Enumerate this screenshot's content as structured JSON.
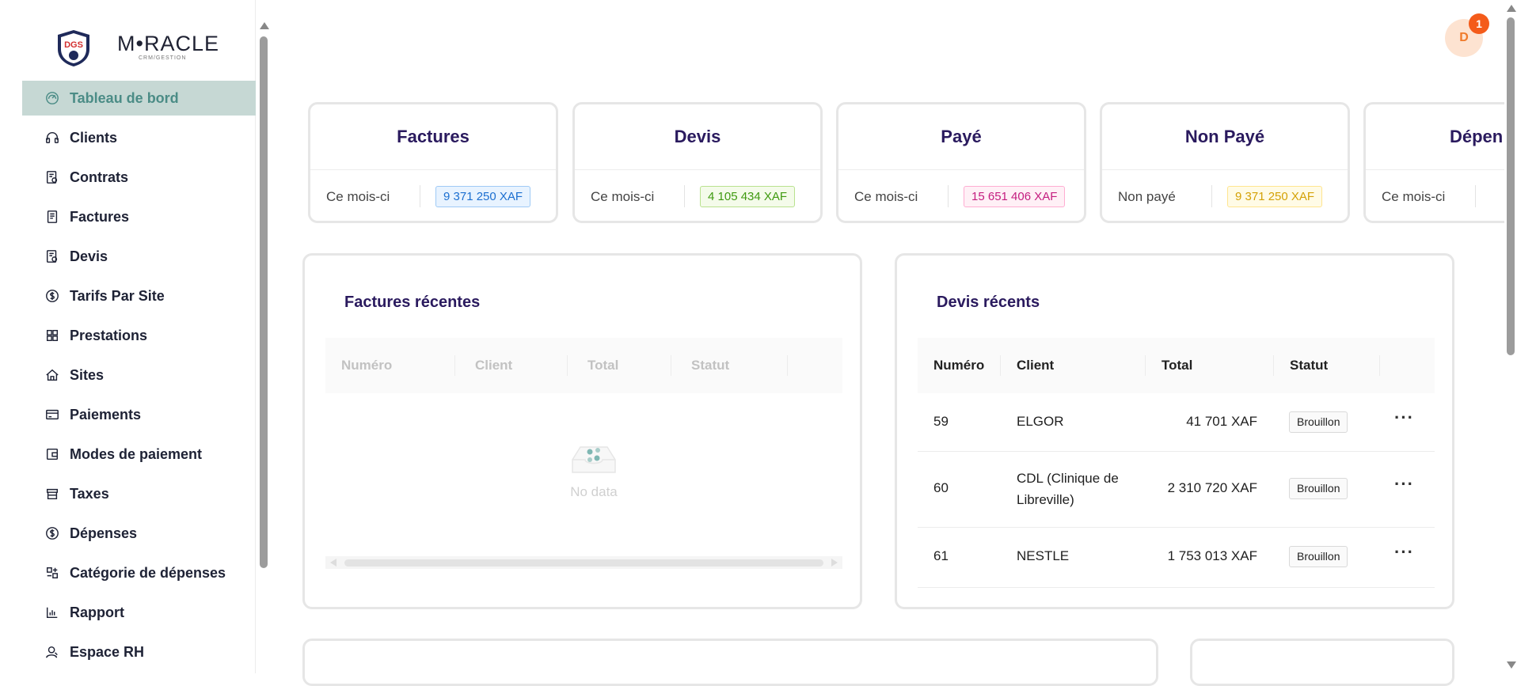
{
  "brand": {
    "name": "M•RACLE",
    "subtitle": "CRM/GESTION",
    "shield_text": "DGS"
  },
  "sidebar": {
    "items": [
      {
        "label": "Tableau de bord",
        "icon": "dashboard-icon",
        "active": true
      },
      {
        "label": "Clients",
        "icon": "headset-icon"
      },
      {
        "label": "Contrats",
        "icon": "contract-icon"
      },
      {
        "label": "Factures",
        "icon": "invoice-icon"
      },
      {
        "label": "Devis",
        "icon": "quote-icon"
      },
      {
        "label": "Tarifs Par Site",
        "icon": "dollar-circle-icon"
      },
      {
        "label": "Prestations",
        "icon": "grid-icon"
      },
      {
        "label": "Sites",
        "icon": "home-icon"
      },
      {
        "label": "Paiements",
        "icon": "credit-card-icon"
      },
      {
        "label": "Modes de paiement",
        "icon": "wallet-icon"
      },
      {
        "label": "Taxes",
        "icon": "shop-icon"
      },
      {
        "label": "Dépenses",
        "icon": "dollar-circle-icon"
      },
      {
        "label": "Catégorie de dépenses",
        "icon": "category-icon"
      },
      {
        "label": "Rapport",
        "icon": "bar-chart-icon"
      },
      {
        "label": "Espace RH",
        "icon": "user-icon"
      }
    ]
  },
  "header": {
    "avatar_initial": "D",
    "notification_count": "1"
  },
  "stats": [
    {
      "title": "Factures",
      "label": "Ce mois-ci",
      "value": "9 371 250 XAF",
      "color": "blue"
    },
    {
      "title": "Devis",
      "label": "Ce mois-ci",
      "value": "4 105 434 XAF",
      "color": "green"
    },
    {
      "title": "Payé",
      "label": "Ce mois-ci",
      "value": "15 651 406 XAF",
      "color": "pink"
    },
    {
      "title": "Non Payé",
      "label": "Non payé",
      "value": "9 371 250 XAF",
      "color": "yellow"
    },
    {
      "title": "Dépen",
      "label": "Ce mois-ci",
      "value": "",
      "color": ""
    }
  ],
  "recent_invoices": {
    "title": "Factures récentes",
    "columns": [
      "Numéro",
      "Client",
      "Total",
      "Statut"
    ],
    "empty_text": "No data"
  },
  "recent_quotes": {
    "title": "Devis récents",
    "columns": [
      "Numéro",
      "Client",
      "Total",
      "Statut"
    ],
    "rows": [
      {
        "numero": "59",
        "client": "ELGOR",
        "total": "41 701 XAF",
        "statut": "Brouillon"
      },
      {
        "numero": "60",
        "client": "CDL (Clinique de Libreville)",
        "total": "2 310 720 XAF",
        "statut": "Brouillon"
      },
      {
        "numero": "61",
        "client": "NESTLE",
        "total": "1 753 013 XAF",
        "statut": "Brouillon"
      }
    ],
    "actions_glyph": "···"
  }
}
